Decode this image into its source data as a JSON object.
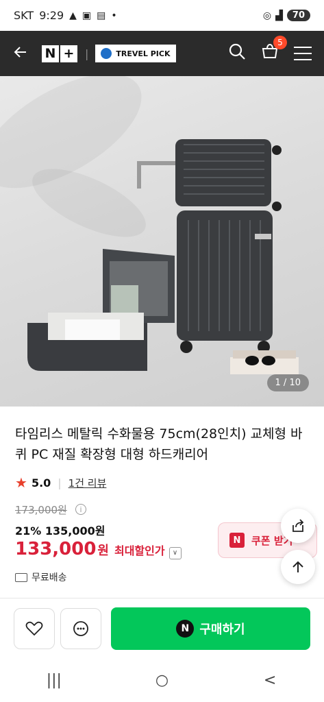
{
  "status_bar": {
    "carrier": "SKT",
    "time": "9:29",
    "battery": "70",
    "icons": [
      "warning-icon",
      "screenshot-icon",
      "notification-icon",
      "dot-icon",
      "hotspot-icon",
      "signal-icon",
      "battery-icon"
    ]
  },
  "top_bar": {
    "nplus_left": "N",
    "nplus_right": "+",
    "divider": "|",
    "brand_name": "TREVEL PICK",
    "cart_count": "5",
    "bg_color": "#2b2b2b"
  },
  "gallery": {
    "counter": "1 / 10"
  },
  "product": {
    "title": "타임리스 메탈릭 수화물용 75cm(28인치) 교체형 바퀴 PC 재질 확장형 대형 하드캐리어",
    "rating": "5.0",
    "review_link": "1건 리뷰",
    "original_price": "173,000원",
    "discount_rate": "21%",
    "discount_price": "135,000원",
    "final_price": "133,000",
    "final_unit": "원",
    "max_discount_label": "최대할인가",
    "shipping": "무료배송",
    "accent_color": "#d9213a"
  },
  "coupon": {
    "icon_letter": "N",
    "label": "쿠폰 받기"
  },
  "bottom_bar": {
    "buy_icon_letter": "N",
    "buy_label": "구매하기",
    "buy_color": "#03c75a"
  },
  "nav": {
    "recent_symbol": "|||",
    "home_symbol": "○",
    "back_symbol": "<"
  }
}
